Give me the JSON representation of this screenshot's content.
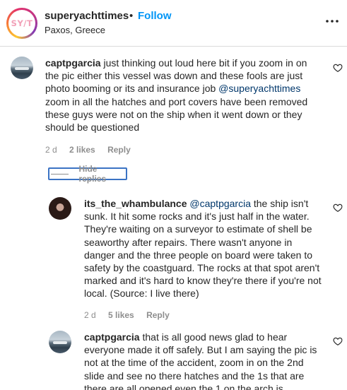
{
  "header": {
    "logo_text": "SY/T",
    "account": "superyachttimes",
    "separator": "•",
    "follow_label": "Follow",
    "location": "Paxos, Greece",
    "more_icon": "more-horizontal-icon"
  },
  "comments": [
    {
      "user": "captpgarcia",
      "text_before": "just thinking out loud here bit if you zoom in on the pic either this vessel was down and these fools are just photo booming or its and insurance job ",
      "mention": "@superyachttimes",
      "text_after": " zoom in all the hatches and port covers have been removed these guys were not on the ship when it went down or they should be questioned",
      "time": "2 d",
      "likes": "2 likes",
      "reply_label": "Reply"
    }
  ],
  "hide_replies_label": "Hide replies",
  "replies": [
    {
      "user": "its_the_whambulance",
      "mention": "@captpgarcia",
      "text_after": " the ship isn't sunk. It hit some rocks and it's just half in the water. They're waiting on a surveyor to estimate of shell be seaworthy after repairs. There wasn't anyone in danger and the three people on board were taken to safety by the coastguard. The rocks at that spot aren't marked and it's hard to know they're there if you're not local. (Source: I live there)",
      "time": "2 d",
      "likes": "5 likes",
      "reply_label": "Reply"
    },
    {
      "user": "captpgarcia",
      "text": "that is all good news glad to hear everyone made it off safely. But I am saying the pic is not at the time of the accident, zoom in on the 2nd slide and see no there hatches and the 1s that are there are all opened even the 1 on the arch is"
    }
  ],
  "icons": {
    "like": "heart-outline-icon",
    "avatar_boat": "boat-photo",
    "avatar_user": "person-photo"
  },
  "colors": {
    "link": "#0095f6",
    "mention": "#00376b",
    "meta": "#8e8e8e",
    "focus_outline": "#3b73c4"
  }
}
